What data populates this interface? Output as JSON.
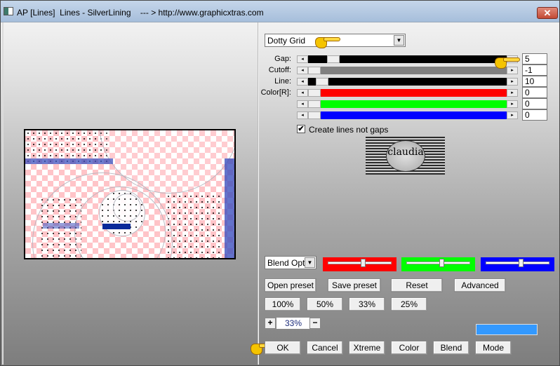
{
  "window": {
    "title": "AP [Lines]  Lines - SilverLining    --- > http://www.graphicxtras.com",
    "close_label": "✕"
  },
  "preset": {
    "selected": "Dotty Grid",
    "arrow": "▼"
  },
  "sliders": [
    {
      "label": "Gap:",
      "value": "5",
      "fraction": 0.1,
      "color": "#000000"
    },
    {
      "label": "Cutoff:",
      "value": "-1",
      "fraction": 0.0,
      "color": "#808080"
    },
    {
      "label": "Line:",
      "value": "10",
      "fraction": 0.04,
      "color": "#000000"
    },
    {
      "label": "Color[R]:",
      "value": "0",
      "fraction": 0.0,
      "color": "#ff0000"
    },
    {
      "label": "",
      "value": "0",
      "fraction": 0.0,
      "color": "#00ff00"
    },
    {
      "label": "",
      "value": "0",
      "fraction": 0.0,
      "color": "#0000ff"
    }
  ],
  "slider_arrows": {
    "left": "◂",
    "right": "▸"
  },
  "checkbox": {
    "label": "Create lines not gaps",
    "checked": true,
    "mark": "✔"
  },
  "logo": {
    "text": "claudia"
  },
  "blend": {
    "selected": "Blend Opti",
    "arrow": "▼",
    "bars": [
      {
        "color": "#ff0000",
        "fraction": 0.55
      },
      {
        "color": "#00ff00",
        "fraction": 0.55
      },
      {
        "color": "#0000ff",
        "fraction": 0.55
      }
    ]
  },
  "buttons": {
    "open_preset": "Open preset",
    "save_preset": "Save preset",
    "reset": "Reset",
    "advanced": "Advanced",
    "zoom_100": "100%",
    "zoom_50": "50%",
    "zoom_33": "33%",
    "zoom_25": "25%",
    "plus": "+",
    "minus": "−",
    "ok": "OK",
    "cancel": "Cancel",
    "xtreme": "Xtreme",
    "color": "Color",
    "blend": "Blend",
    "mode": "Mode"
  },
  "zoom_level": "33%",
  "swatch_color": "#3399ff"
}
